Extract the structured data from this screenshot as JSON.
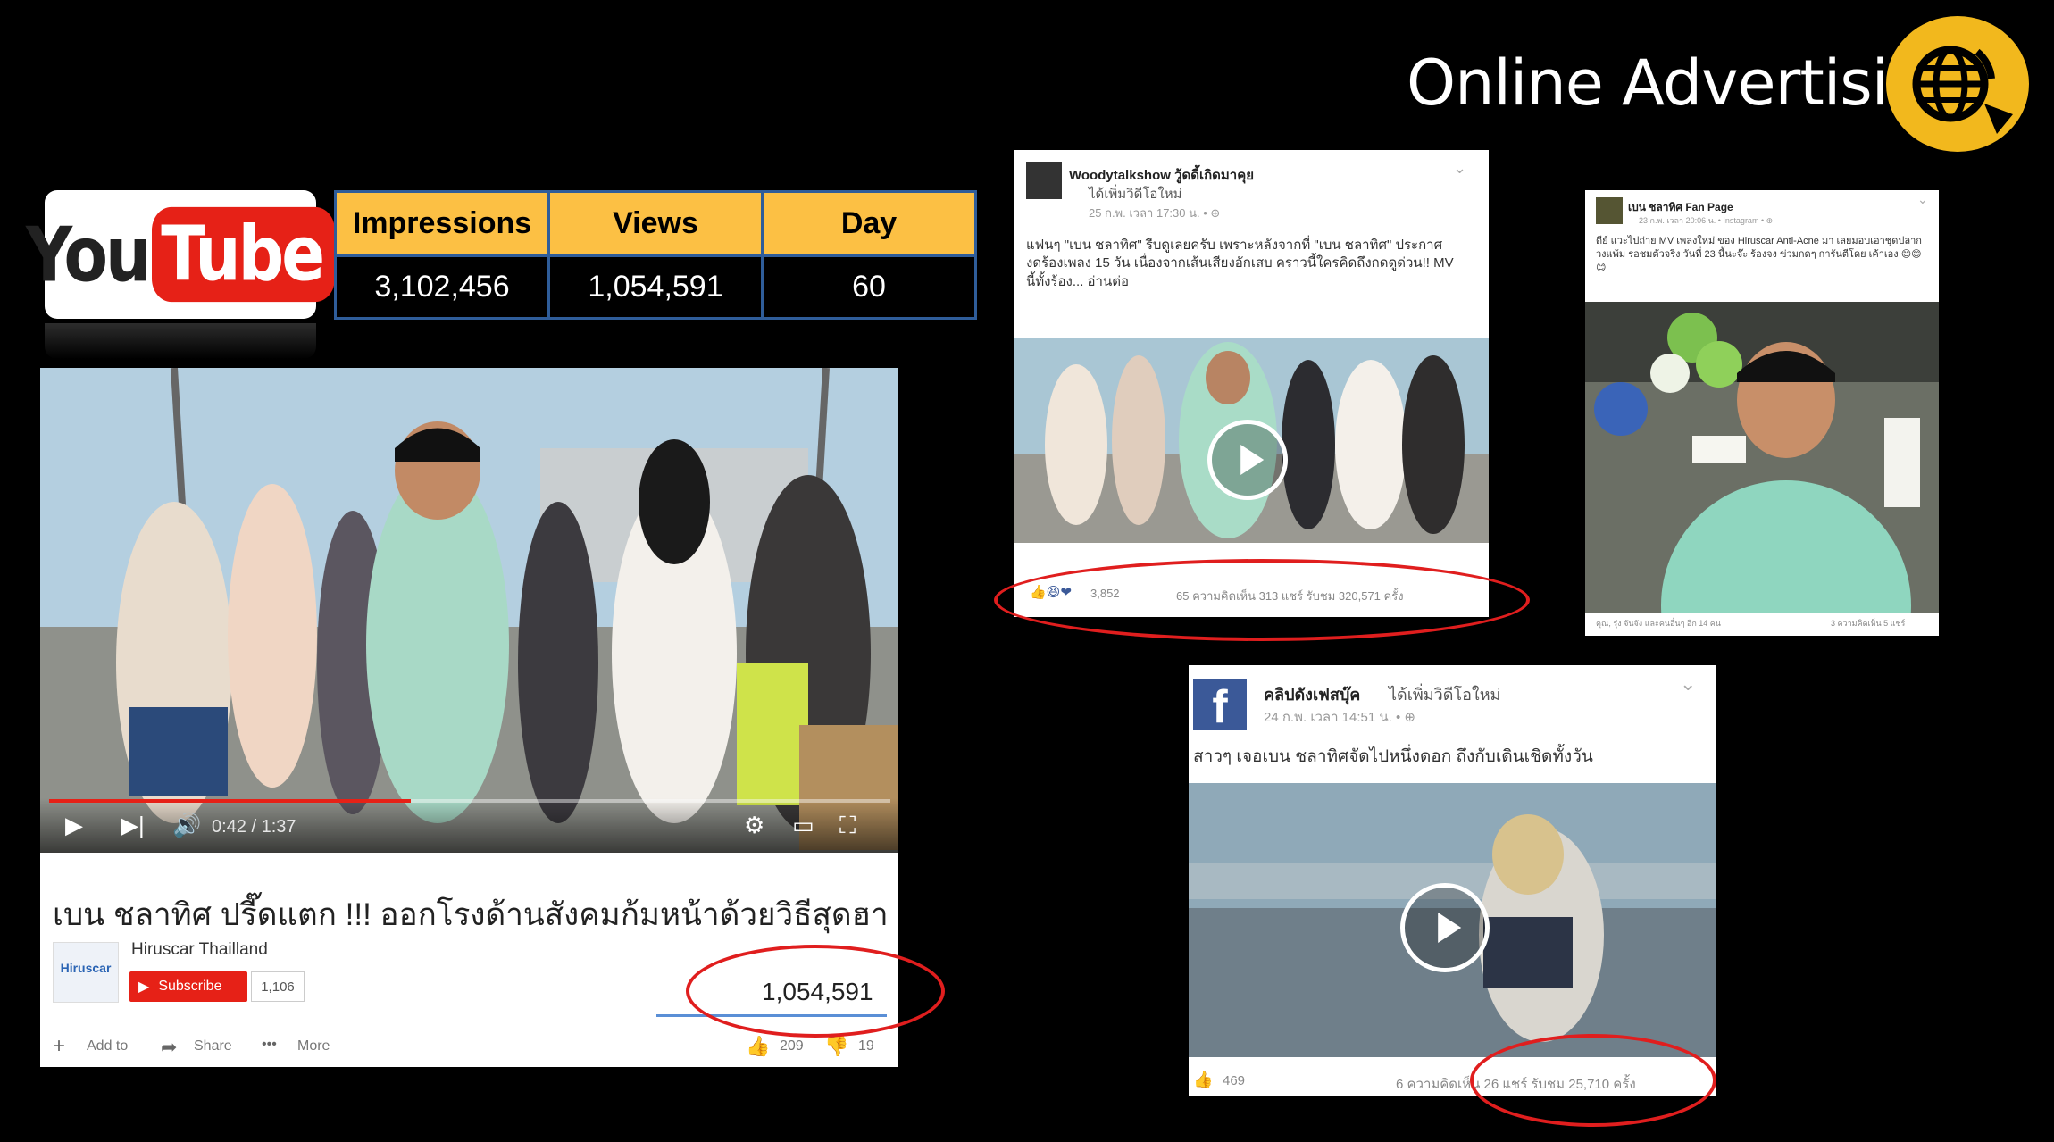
{
  "title": "Online Advertising",
  "youtube_logo": {
    "you": "You",
    "tube": "Tube"
  },
  "stats": {
    "headers": [
      "Impressions",
      "Views",
      "Day"
    ],
    "values": [
      "3,102,456",
      "1,054,591",
      "60"
    ]
  },
  "video": {
    "time": "0:42 / 1:37",
    "progress": 0.43,
    "title": "เบน ชลาทิศ ปรี๊ดแตก !!! ออกโรงด้านสังคมก้มหน้าด้วยวิธีสุดฮา",
    "channel": "Hiruscar Thailland",
    "channel_avatar_text": "Hiruscar",
    "subscribe_label": "Subscribe",
    "subscriber_count": "1,106",
    "views": "1,054,591",
    "actions": {
      "add": "Add to",
      "share": "Share",
      "more": "More"
    },
    "likes": "209",
    "dislikes": "19"
  },
  "fb_post_1": {
    "page": "Woodytalkshow วู้ดดี้เกิดมาคุย",
    "added": "ได้เพิ่มวิดีโอใหม่",
    "meta": "25 ก.พ. เวลา 17:30 น. • ⊕",
    "text": "แฟนๆ \"เบน ชลาทิศ\" รีบดูเลยครับ เพราะหลังจากที่ \"เบน ชลาทิศ\" ประกาศงดร้องเพลง 15 วัน เนื่องจากเส้นเสียงอักเสบ คราวนี้ใครคิดถึงกดดูด่วน!! MV นี้ทั้งร้อง... อ่านต่อ",
    "reactions": "3,852",
    "stats": "65 ความคิดเห็น  313 แชร์  รับชม 320,571 ครั้ง"
  },
  "fb_post_2": {
    "page": "เบน ชลาทิศ Fan Page",
    "meta": "23 ก.พ. เวลา 20:06 น. • Instagram • ⊕",
    "text": "ดีย์ แวะไปถ่าย MV เพลงใหม่ ของ Hiruscar Anti-Acne มา เลยมอบเอาชุดปลากวงแพ้ม รอชมตัวจริง วันที่ 23 นี้นะจ๊ะ ร้องจง ข่วมกดๆ การันตีโดย เค้าเอง 😊😊😊",
    "footer_left": "คุณ, รุ่ง จันจัง และคนอื่นๆ อีก 14 คน",
    "footer_right": "3 ความคิดเห็น 5 แชร์"
  },
  "fb_post_3": {
    "page": "คลิปดังเฟสบุ๊ค",
    "added": "ได้เพิ่มวิดีโอใหม่",
    "meta": "24 ก.พ. เวลา 14:51 น. • ⊕",
    "text": "สาวๆ เจอเบน ชลาทิศจัดไปหนึ่งดอก ถึงกับเดินเชิดทั้งวัน",
    "reactions": "469",
    "stats": "6 ความคิดเห็น 26 แชร์ รับชม 25,710 ครั้ง"
  }
}
